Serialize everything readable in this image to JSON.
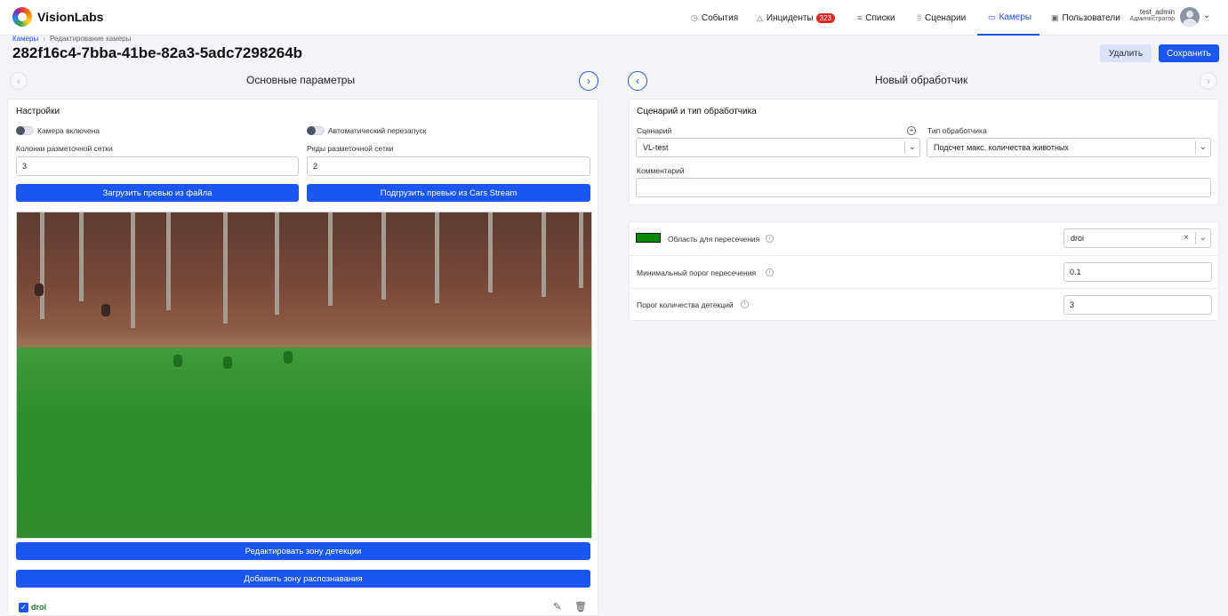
{
  "header": {
    "brand": "VisionLabs",
    "nav": [
      {
        "label": "События",
        "icon": "clock-icon"
      },
      {
        "label": "Инциденты",
        "icon": "warning-icon",
        "badge": "323"
      },
      {
        "label": "Списки",
        "icon": "list-icon"
      },
      {
        "label": "Сценарии",
        "icon": "scenario-icon"
      },
      {
        "label": "Камеры",
        "icon": "camera-icon",
        "active": true
      },
      {
        "label": "Пользователи",
        "icon": "users-icon"
      }
    ],
    "user": {
      "name": "test_admin",
      "role": "Администратор"
    }
  },
  "breadcrumb": {
    "root": "Камеры",
    "current": "Редактирование камеры"
  },
  "page_title": "282f16c4-7bba-41be-82a3-5adc7298264b",
  "actions": {
    "delete": "Удалить",
    "save": "Сохранить"
  },
  "left": {
    "section_title": "Основные параметры",
    "panel_title": "Настройки",
    "camera_enabled": "Камера включена",
    "auto_restart": "Автоматический перезапуск",
    "grid_columns_label": "Колонки разметочной сетки",
    "grid_columns_value": "3",
    "grid_rows_label": "Ряды разметочной сетки",
    "grid_rows_value": "2",
    "upload_preview": "Загрузить превью из файла",
    "load_preview_stream": "Подгрузить превью из Cars Stream",
    "edit_zone": "Редактировать зону детекции",
    "add_zone": "Добавить зону распознавания",
    "zone_name": "droi"
  },
  "right": {
    "section_title": "Новый обработчик",
    "panel_title": "Сценарий и тип обработчика",
    "scenario_label": "Сценарий",
    "scenario_value": "VL-test",
    "handler_type_label": "Тип обработчика",
    "handler_type_value": "Подсчет макс. количества животных",
    "comment_label": "Комментарий",
    "comment_value": "",
    "area_label": "Область для пересечения",
    "area_value": "droi",
    "area_color": "#0a8a0a",
    "min_threshold_label": "Минимальный порог пересечения",
    "min_threshold_value": "0.1",
    "det_threshold_label": "Порог количества детекций",
    "det_threshold_value": "3"
  }
}
